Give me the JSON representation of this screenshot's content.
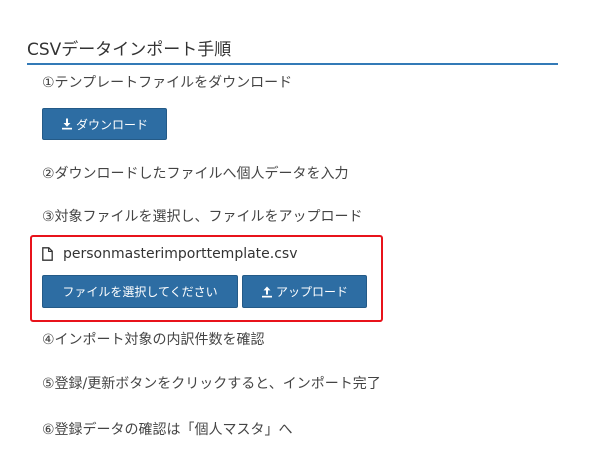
{
  "page": {
    "title": "CSVデータインポート手順"
  },
  "steps": {
    "step1": "①テンプレートファイルをダウンロード",
    "step2": "②ダウンロードしたファイルへ個人データを入力",
    "step3": "③対象ファイルを選択し、ファイルをアップロード",
    "step4": "④インポート対象の内訳件数を確認",
    "step5": "⑤登録/更新ボタンをクリックすると、インポート完了",
    "step6": "⑥登録データの確認は「個人マスタ」へ"
  },
  "buttons": {
    "download_label": "ダウンロード",
    "choose_file_label": "ファイルを選択してください",
    "upload_label": "アップロード"
  },
  "file": {
    "name": "personmasterimporttemplate.csv"
  },
  "icons": {
    "download": "download-icon",
    "upload": "upload-icon",
    "file": "file-icon"
  },
  "colors": {
    "accent": "#337ab7",
    "button": "#2d6da3",
    "highlight": "#e8131b"
  }
}
